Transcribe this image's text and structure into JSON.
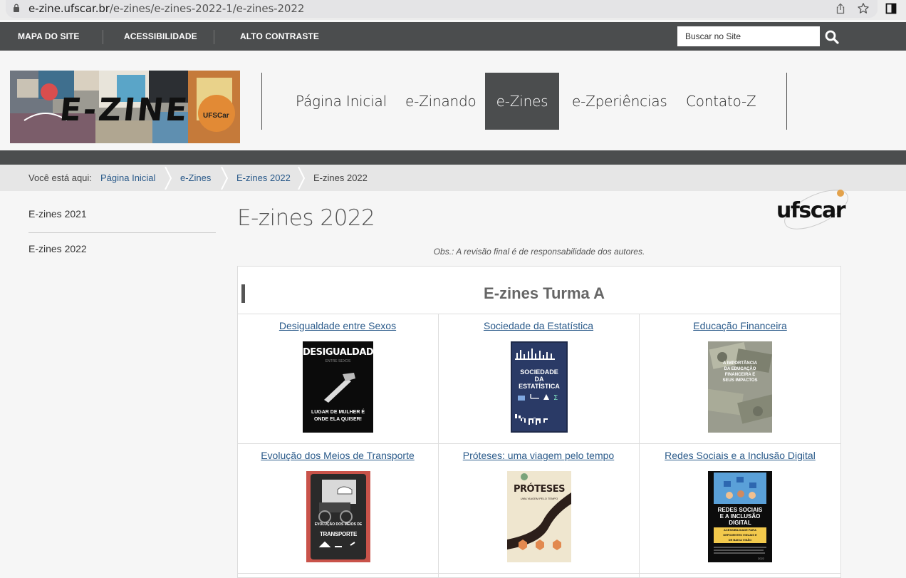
{
  "browser": {
    "url_domain": "e-zine.ufscar.br",
    "url_path": "/e-zines/e-zines-2022-1/e-zines-2022"
  },
  "topbar": {
    "links": [
      "MAPA DO SITE",
      "ACESSIBILIDADE",
      "ALTO CONTRASTE"
    ],
    "search_placeholder": "Buscar no Site"
  },
  "header": {
    "logo_text": "E-ZINE",
    "logo_badge": "UFSCar",
    "nav": [
      "Página Inicial",
      "e-Zinando",
      "e-Zines",
      "e-Zperiências",
      "Contato-Z"
    ],
    "active_nav": "e-Zines"
  },
  "breadcrumb": {
    "label": "Você está aqui:",
    "items": [
      "Página Inicial",
      "e-Zines",
      "E-zines 2022",
      "E-zines 2022"
    ]
  },
  "sidebar": {
    "items": [
      "E-zines 2021",
      "E-zines 2022"
    ]
  },
  "main": {
    "title": "E-zines 2022",
    "ufscar_logo": "ufscar",
    "obs": "Obs.: A revisão final é de responsabilidade dos autores.",
    "section_title": "E-zines Turma A",
    "zines": [
      {
        "title": "Desigualdade entre Sexos",
        "cover_lines": [
          "DESIGUALDADE",
          "ENTRE SEXOS",
          "LUGAR DE MULHER É",
          "ONDE ELA QUISER!"
        ]
      },
      {
        "title": "Sociedade da Estatística",
        "cover_lines": [
          "SOCIEDADE",
          "DA",
          "ESTATÍSTICA"
        ]
      },
      {
        "title": "Educação Financeira",
        "cover_lines": [
          "A IMPORTÂNCIA",
          "DA EDUCAÇÃO",
          "FINANCEIRA E",
          "SEUS IMPACTOS"
        ]
      },
      {
        "title": "Evolução dos Meios de Transporte",
        "cover_lines": [
          "EVOLUÇÃO DOS MEIOS DE",
          "TRANSPORTE"
        ]
      },
      {
        "title": "Próteses: uma viagem pelo tempo",
        "cover_lines": [
          "PRÓTESES",
          "UMA VIAGEM PELO TEMPO"
        ]
      },
      {
        "title": "Redes Sociais e a Inclusão Digital",
        "cover_lines": [
          "REDES SOCIAIS",
          "E A INCLUSÃO",
          "DIGITAL",
          "ACESSIBILIDADE PARA",
          "DEFICIENTES VISUAIS E",
          "DE BAIXA VISÃO",
          "2022"
        ]
      }
    ]
  },
  "colors": {
    "dark_gray": "#4b4d4e",
    "link_blue": "#2a5a8a"
  }
}
